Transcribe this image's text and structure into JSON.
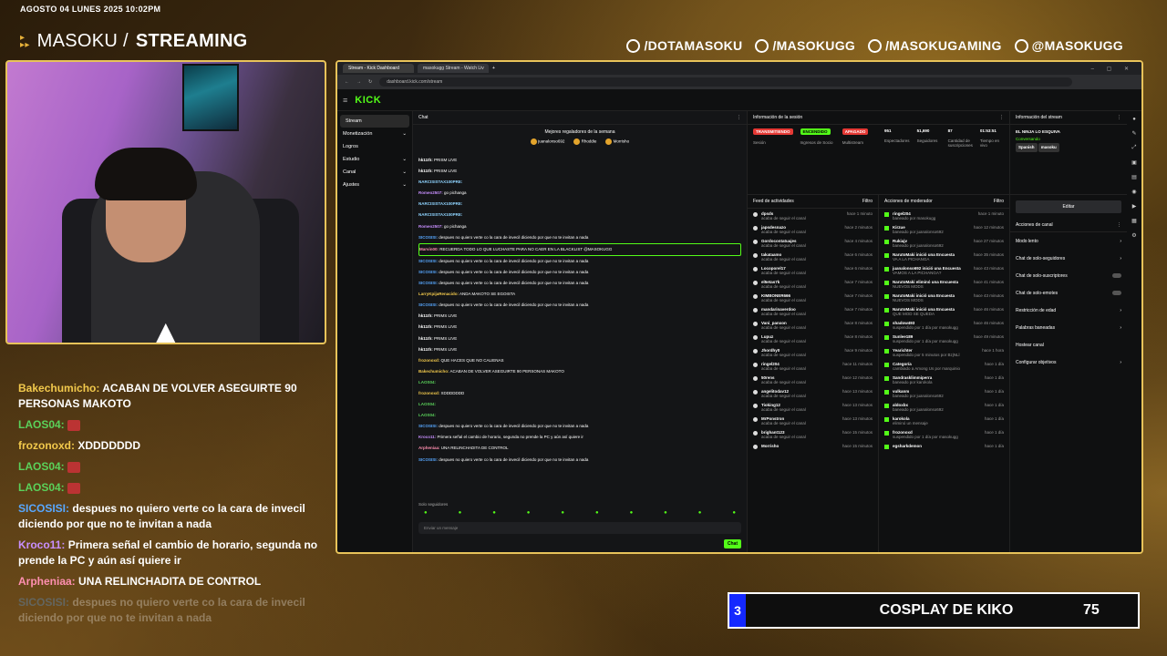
{
  "overlay": {
    "date": "AGOSTO 04 LUNES 2025 10:02PM",
    "brand_light": "MASOKU /",
    "brand_bold": "STREAMING",
    "socials": [
      {
        "icon": "facebook-icon",
        "label": "/DOTAMASOKU"
      },
      {
        "icon": "instagram-icon",
        "label": "/MASOKUGG"
      },
      {
        "icon": "youtube-icon",
        "label": "/MASOKUGAMING"
      },
      {
        "icon": "tiktok-icon",
        "label": "@MASOKUGG"
      }
    ],
    "banner": {
      "rank": "3",
      "title": "COSPLAY DE KIKO",
      "score": "75"
    }
  },
  "stream_chat": [
    {
      "user": "Bakechumicho:",
      "text": "ACABAN DE VOLVER ASEGUIRTE 90 PERSONAS MAKOTO",
      "color": "yellow"
    },
    {
      "user": "LAOS04:",
      "text": "",
      "color": "green",
      "emote": true
    },
    {
      "user": "frozonoxd:",
      "text": "XDDDDDDD",
      "color": "yellow"
    },
    {
      "user": "LAOS04:",
      "text": "",
      "color": "green",
      "emote": true
    },
    {
      "user": "LAOS04:",
      "text": "",
      "color": "green",
      "emote": true
    },
    {
      "user": "SICOSISI:",
      "text": "despues no quiero verte co la cara de invecil diciendo por que no te invitan a nada",
      "color": "blue"
    },
    {
      "user": "Kroco11:",
      "text": "Primera señal el cambio de horario, segunda no prende la PC y aún así quiere ir",
      "color": "purple"
    },
    {
      "user": "Arpheniaa:",
      "text": "UNA RELINCHADITA DE CONTROL",
      "color": "pink"
    },
    {
      "user": "SICOSISI:",
      "text": "despues no quiero verte co la cara de invecil diciendo por que no te invitan a nada",
      "color": "blue",
      "faded": true
    }
  ],
  "browser": {
    "tabs": [
      "Stream - Kick Dashboard",
      "masokugg Stream - Watch Liv"
    ],
    "url": "dashboard.kick.com/stream",
    "logo": "KICK",
    "nav": [
      {
        "label": "Stream",
        "active": true
      },
      {
        "label": "Monetización",
        "chev": "⌄"
      },
      {
        "label": "Logros"
      },
      {
        "label": "Estudio",
        "chev": "⌄"
      },
      {
        "label": "Canal",
        "chev": "⌄"
      },
      {
        "label": "Ajustes",
        "chev": "⌄"
      }
    ],
    "chat": {
      "title": "Chat",
      "gifters_title": "Mejores regaladores de la semana",
      "gifters": [
        "juanalonso692",
        "Rhoddie",
        "Morrisho"
      ],
      "messages": [
        {
          "u": "hk11th:",
          "t": "PRISM LIVE",
          "c": "#fff"
        },
        {
          "u": "hk11th:",
          "t": "PRISM LIVE",
          "c": "#fff"
        },
        {
          "u": "NARCISISTAX100PRE:",
          "t": "",
          "c": "#8fd4ff"
        },
        {
          "u": "Romeo2507:",
          "t": "go pichanga",
          "c": "#c88fff"
        },
        {
          "u": "NARCISISTAX100PRE:",
          "t": "",
          "c": "#8fd4ff"
        },
        {
          "u": "NARCISISTAX100PRE:",
          "t": "",
          "c": "#8fd4ff"
        },
        {
          "u": "Romeo2507:",
          "t": "go pichanga",
          "c": "#c88fff"
        },
        {
          "u": "SICOSISI:",
          "t": "despues no quiero verte co la cara de invecil diciendo por que no te invitan a nada",
          "c": "#58a8ff"
        },
        {
          "u": "Marvin00:",
          "t": "RECUERDA TODO LO QUE LUCHASTE PARA NO CAER EN LA BLACKLIST @MASOKUGG",
          "c": "#ff8fb0",
          "hl": true
        },
        {
          "u": "SICOSISI:",
          "t": "despues no quiero verte co la cara de invecil diciendo por que no te invitan a nada",
          "c": "#58a8ff"
        },
        {
          "u": "SICOSISI:",
          "t": "despues no quiero verte co la cara de invecil diciendo por que no te invitan a nada",
          "c": "#58a8ff"
        },
        {
          "u": "SICOSISI:",
          "t": "despues no quiero verte co la cara de invecil diciendo por que no te invitan a nada",
          "c": "#58a8ff"
        },
        {
          "u": "LarryKpijaRenacido:",
          "t": "ANDA MAKOTO SE EGOISTA",
          "c": "#f2c94c"
        },
        {
          "u": "SICOSISI:",
          "t": "despues no quiero verte co la cara de invecil diciendo por que no te invitan a nada",
          "c": "#58a8ff"
        },
        {
          "u": "hk11th:",
          "t": "PRIMS LIVE",
          "c": "#fff"
        },
        {
          "u": "hk11th:",
          "t": "PRIMS LIVE",
          "c": "#fff"
        },
        {
          "u": "hk11th:",
          "t": "PRIMS LIVE",
          "c": "#fff"
        },
        {
          "u": "hk11th:",
          "t": "PRIMS LIVE",
          "c": "#fff"
        },
        {
          "u": "frozonoxd:",
          "t": "QUE HACES QUE NO CALIENAS",
          "c": "#f2c94c"
        },
        {
          "u": "Bakechumicho:",
          "t": "ACABAN DE VOLVER ASEGUIRTE 90 PERSONAS MAKOTO",
          "c": "#f2c94c"
        },
        {
          "u": "LAOS04:",
          "t": "",
          "c": "#5ad15a"
        },
        {
          "u": "frozonoxd:",
          "t": "XDDDDDDD",
          "c": "#f2c94c"
        },
        {
          "u": "LAOS04:",
          "t": "",
          "c": "#5ad15a"
        },
        {
          "u": "LAOS04:",
          "t": "",
          "c": "#5ad15a"
        },
        {
          "u": "SICOSISI:",
          "t": "despues no quiero verte co la cara de invecil diciendo por que no te invitan a nada",
          "c": "#58a8ff"
        },
        {
          "u": "Kroco11:",
          "t": "Primera señal el cambio de horario, segunda no prende la PC y aún así quiere ir",
          "c": "#c88fff"
        },
        {
          "u": "Arpheniaa:",
          "t": "UNA RELINCHADITA DE CONTROL",
          "c": "#ff8fb0"
        },
        {
          "u": "SICOSISI:",
          "t": "despues no quiero verte co la cara de invecil diciendo por que no te invitan a nada",
          "c": "#58a8ff"
        }
      ],
      "followers_only": "Solo seguidores",
      "input_placeholder": "Enviar un mensaje",
      "send_label": "Chat"
    },
    "session": {
      "title": "Información de la sesión",
      "badges": [
        {
          "label": "TRANSMITIENDO",
          "color": "#e53935",
          "sub": "Sesión"
        },
        {
          "label": "ENCENDIDO",
          "color": "#53fc18",
          "sub": "Ingresos de Socio"
        },
        {
          "label": "APAGADO",
          "color": "#e53935",
          "sub": "Multistream"
        }
      ],
      "stats": [
        {
          "v": "951",
          "l": "Espectadores"
        },
        {
          "v": "51,690",
          "l": "Seguidores"
        },
        {
          "v": "87",
          "l": "Cantidad de suscripciones"
        },
        {
          "v": "01:53:51",
          "l": "Tiempo en vivo"
        }
      ]
    },
    "stream_info": {
      "title": "Información del stream",
      "stream_title": "EL NINJA LO ESQUIVA",
      "category": "Conversando",
      "tags": [
        "Spanish",
        "masoku"
      ],
      "edit_label": "Editar"
    },
    "feed": {
      "title": "Feed de actividades",
      "filter": "Filtro",
      "items": [
        {
          "n": "dpsds",
          "s": "acaba de seguir el canal",
          "t": "hace 1 minuto"
        },
        {
          "n": "japsdesnazo",
          "s": "acaba de seguir el canal",
          "t": "hace 2 minutos"
        },
        {
          "n": "Gordocontatuajes",
          "s": "acaba de seguir el canal",
          "t": "hace 4 minutos"
        },
        {
          "n": "takataamo",
          "s": "acaba de seguir el canal",
          "t": "hace 6 minutos"
        },
        {
          "n": "Locoporel17",
          "s": "acaba de seguir el canal",
          "t": "hace 6 minutos"
        },
        {
          "n": "el5etas7k",
          "s": "acaba de seguir el canal",
          "t": "hace 7 minutos"
        },
        {
          "n": "KIMBONER666",
          "s": "acaba de seguir el canal",
          "t": "hace 7 minutos"
        },
        {
          "n": "mandarinaverdoo",
          "s": "acaba de seguir el canal",
          "t": "hace 7 minutos"
        },
        {
          "n": "Vani_panxon",
          "s": "acaba de seguir el canal",
          "t": "hace 8 minutos"
        },
        {
          "n": "Lupuz",
          "s": "acaba de seguir el canal",
          "t": "hace 8 minutos"
        },
        {
          "n": "Jhordhy0",
          "s": "acaba de seguir el canal",
          "t": "hace 9 minutos"
        },
        {
          "n": "ringel204",
          "s": "acaba de seguir el canal",
          "t": "hace 11 minutos"
        },
        {
          "n": "50rens",
          "s": "acaba de seguir el canal",
          "t": "hace 12 minutos"
        },
        {
          "n": "angelitodav12",
          "s": "acaba de seguir el canal",
          "t": "hace 13 minutos"
        },
        {
          "n": "Tioking12",
          "s": "acaba de seguir el canal",
          "t": "hace 13 minutos"
        },
        {
          "n": "MrPonstron",
          "s": "acaba de seguir el canal",
          "t": "hace 13 minutos"
        },
        {
          "n": "brighant123",
          "s": "acaba de seguir el canal",
          "t": "hace 15 minutos"
        },
        {
          "n": "Morrisho",
          "s": "",
          "t": "hace 15 minutos"
        }
      ]
    },
    "mod": {
      "title": "Acciones de moderador",
      "filter": "Filtro",
      "items": [
        {
          "n": "ringel204",
          "s": "baneado por masokugg",
          "t": "hace 1 minuto"
        },
        {
          "n": "Kirzue",
          "s": "baneado por juanalonso692",
          "t": "hace 12 minutos"
        },
        {
          "n": "Rukiajv",
          "s": "baneado por juanalonso692",
          "t": "hace 27 minutos"
        },
        {
          "n": "NarutoMaki inició una Encuesta",
          "s": "VA A LA PICHANGA",
          "t": "hace 35 minutos"
        },
        {
          "n": "juanalonso692 inició una Encuesta",
          "s": "VAMOS A LA PICHANGA?",
          "t": "hace 43 minutos"
        },
        {
          "n": "NarutoMaki eliminó una Encuesta",
          "s": "NUEVOS MODS",
          "t": "hace 41 minutos"
        },
        {
          "n": "NarutoMaki inició una Encuesta",
          "s": "NUEVOS MODS",
          "t": "hace 43 minutos"
        },
        {
          "n": "NarutoMaki inició una Encuesta",
          "s": "QUE MOD SE QUEDA",
          "t": "hace 46 minutos"
        },
        {
          "n": "shadow493",
          "s": "suspendido por 1 día por masokugg",
          "t": "hace 46 minutos"
        },
        {
          "n": "Sunlee189",
          "s": "suspendido por 1 día por masokugg",
          "t": "hace 49 minutos"
        },
        {
          "n": "Yearichter",
          "s": "suspendido por 5 minutos por BzjNLl",
          "t": "hace 1 hora"
        },
        {
          "n": "Categoría",
          "s": "cambiado a Among Us por marquinio",
          "t": "hace 1 día"
        },
        {
          "n": "Sandrasklimmiperra",
          "s": "baneado por karokola",
          "t": "hace 1 día"
        },
        {
          "n": "vulkanm",
          "s": "baneado por juanalonso692",
          "t": "hace 1 día"
        },
        {
          "n": "aldoxbx",
          "s": "baneado por juanalonso692",
          "t": "hace 1 día"
        },
        {
          "n": "karokola",
          "s": "eliminó un mensaje",
          "t": "hace 1 día"
        },
        {
          "n": "frozonoxd",
          "s": "suspendido por 1 día por masokugg",
          "t": "hace 1 día"
        },
        {
          "n": "egsharkdemon",
          "s": "",
          "t": "hace 1 día"
        }
      ]
    },
    "channel_actions": {
      "title": "Acciones de canal",
      "items": [
        {
          "l": "Modo lento",
          "ctl": "›"
        },
        {
          "l": "Chat de solo-seguidores",
          "ctl": "›",
          "sub": "1 min"
        },
        {
          "l": "Chat de solo-suscriptores",
          "ctl": "toggle"
        },
        {
          "l": "Chat de solo-emotes",
          "ctl": "toggle"
        },
        {
          "l": "Restricción de edad",
          "ctl": "›"
        },
        {
          "l": "Palabras baneadas",
          "ctl": "›"
        },
        {
          "l": "Hostear canal",
          "ctl": ""
        },
        {
          "l": "Configurar objetivos",
          "ctl": "›"
        }
      ]
    }
  },
  "colors": {
    "kick_green": "#53fc18",
    "frame_gold": "#e8c35a",
    "banner_blue": "#1428ff"
  }
}
